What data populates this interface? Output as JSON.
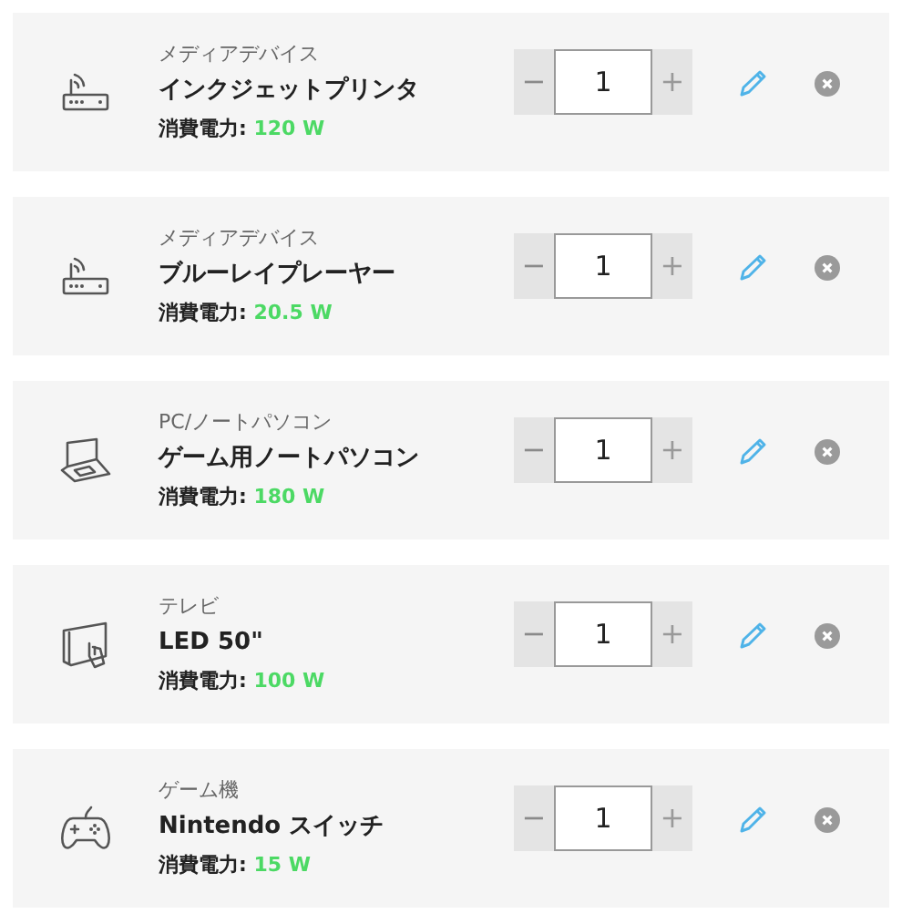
{
  "devices": [
    {
      "kind": "router",
      "category": "メディアデバイス",
      "name": "インクジェットプリンタ",
      "power_label": "消費電力:",
      "power": "120 W",
      "quantity": "1",
      "minus": "−",
      "plus": "+"
    },
    {
      "kind": "router",
      "category": "メディアデバイス",
      "name": "ブルーレイプレーヤー",
      "power_label": "消費電力:",
      "power": "20.5 W",
      "quantity": "1",
      "minus": "−",
      "plus": "+"
    },
    {
      "kind": "laptop",
      "category": "PC/ノートパソコン",
      "name": "ゲーム用ノートパソコン",
      "power_label": "消費電力:",
      "power": "180 W",
      "quantity": "1",
      "minus": "−",
      "plus": "+"
    },
    {
      "kind": "tablet",
      "category": "テレビ",
      "name": "LED 50\"",
      "power_label": "消費電力:",
      "power": "100 W",
      "quantity": "1",
      "minus": "−",
      "plus": "+"
    },
    {
      "kind": "gamepad",
      "category": "ゲーム機",
      "name": "Nintendo スイッチ",
      "power_label": "消費電力:",
      "power": "15 W",
      "quantity": "1",
      "minus": "−",
      "plus": "+"
    }
  ]
}
